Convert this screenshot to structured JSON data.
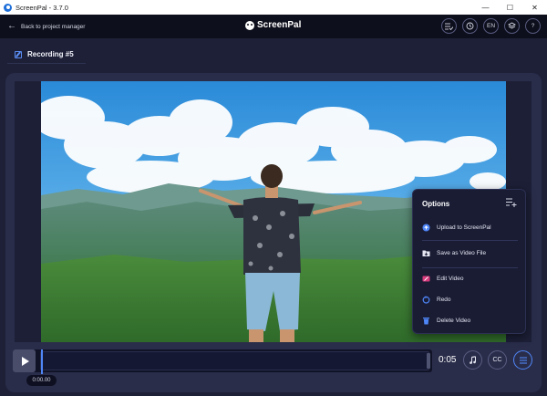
{
  "window": {
    "title": "ScreenPal - 3.7.0",
    "minimize": "—",
    "maximize": "☐",
    "close": "✕"
  },
  "header": {
    "back_label": "Back to project manager",
    "brand": "ScreenPal",
    "icons": [
      "checklist-icon",
      "history-icon",
      "language-icon",
      "layers-icon",
      "help-icon"
    ],
    "language": "EN",
    "help": "?"
  },
  "recording": {
    "title": "Recording #5"
  },
  "options_menu": {
    "title": "Options",
    "items": [
      {
        "label": "Upload to ScreenPal",
        "icon": "upload-icon"
      },
      {
        "label": "Save as Video File",
        "icon": "save-file-icon"
      },
      {
        "label": "Edit Video",
        "icon": "edit-video-icon"
      },
      {
        "label": "Redo",
        "icon": "redo-icon"
      },
      {
        "label": "Delete Video",
        "icon": "delete-icon"
      }
    ]
  },
  "player": {
    "duration": "0:05",
    "current_time": "0:00.00",
    "playhead_fraction": 0,
    "cc_label": "CC"
  },
  "colors": {
    "accent": "#4f86f7",
    "background": "#1e2038",
    "panel": "#2a2d4a",
    "header": "#0e0f1c"
  }
}
